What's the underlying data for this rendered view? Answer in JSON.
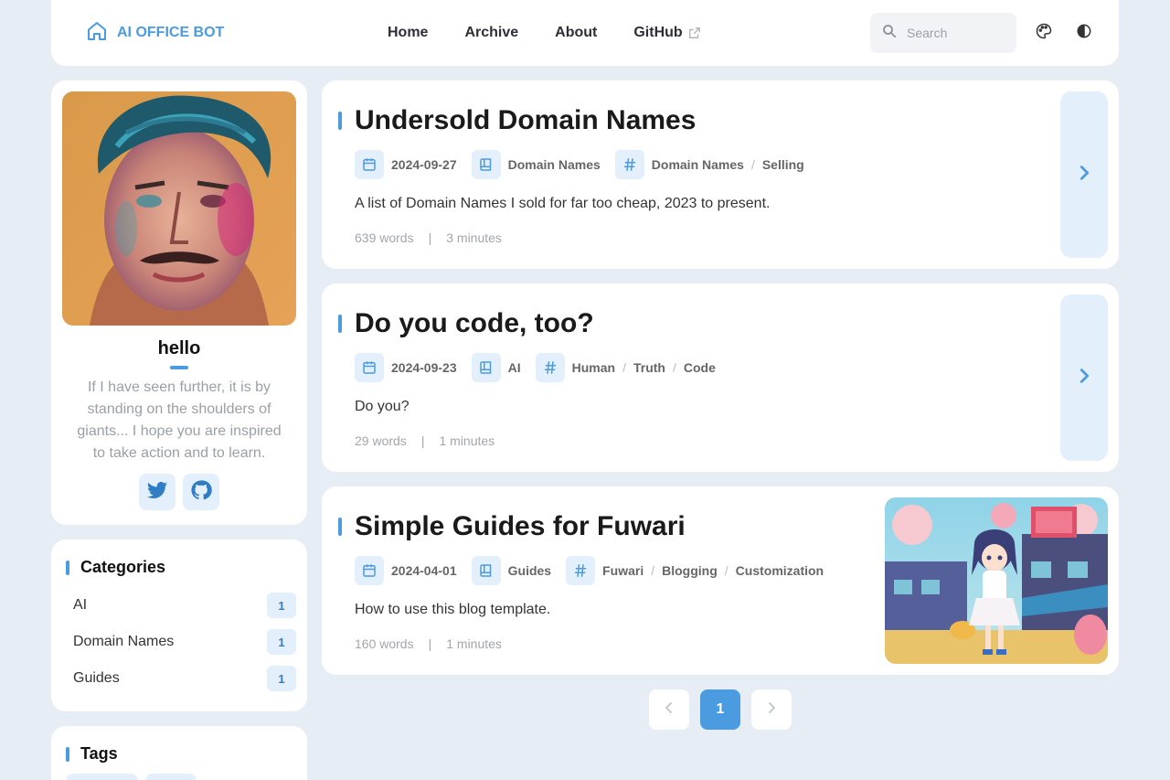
{
  "nav": {
    "brand": "AI OFFICE BOT",
    "links": [
      "Home",
      "Archive",
      "About",
      "GitHub"
    ],
    "search_placeholder": "Search"
  },
  "profile": {
    "name": "hello",
    "bio": "If I have seen further, it is by standing on the shoulders of giants... I hope you are inspired to take action and to learn."
  },
  "categories": {
    "title": "Categories",
    "items": [
      {
        "label": "AI",
        "count": "1"
      },
      {
        "label": "Domain Names",
        "count": "1"
      },
      {
        "label": "Guides",
        "count": "1"
      }
    ]
  },
  "tags": {
    "title": "Tags"
  },
  "posts": [
    {
      "title": "Undersold Domain Names",
      "date": "2024-09-27",
      "category": "Domain Names",
      "tags": [
        "Domain Names",
        "Selling"
      ],
      "description": "A list of Domain Names I sold for far too cheap, 2023 to present.",
      "words": "639 words",
      "minutes": "3 minutes"
    },
    {
      "title": "Do you code, too?",
      "date": "2024-09-23",
      "category": "AI",
      "tags": [
        "Human",
        "Truth",
        "Code"
      ],
      "description": "Do you?",
      "words": "29 words",
      "minutes": "1 minutes"
    },
    {
      "title": "Simple Guides for Fuwari",
      "date": "2024-04-01",
      "category": "Guides",
      "tags": [
        "Fuwari",
        "Blogging",
        "Customization"
      ],
      "description": "How to use this blog template.",
      "words": "160 words",
      "minutes": "1 minutes"
    }
  ],
  "pagination": {
    "current": "1"
  },
  "colors": {
    "accent": "#4a9be0",
    "accent_soft": "#e4effc",
    "background": "#e7edf5"
  },
  "icons": {
    "brand": "home-icon",
    "date": "calendar-icon",
    "category": "book-icon",
    "tags": "hash-icon",
    "theme": "palette-icon",
    "mode": "contrast-icon"
  }
}
